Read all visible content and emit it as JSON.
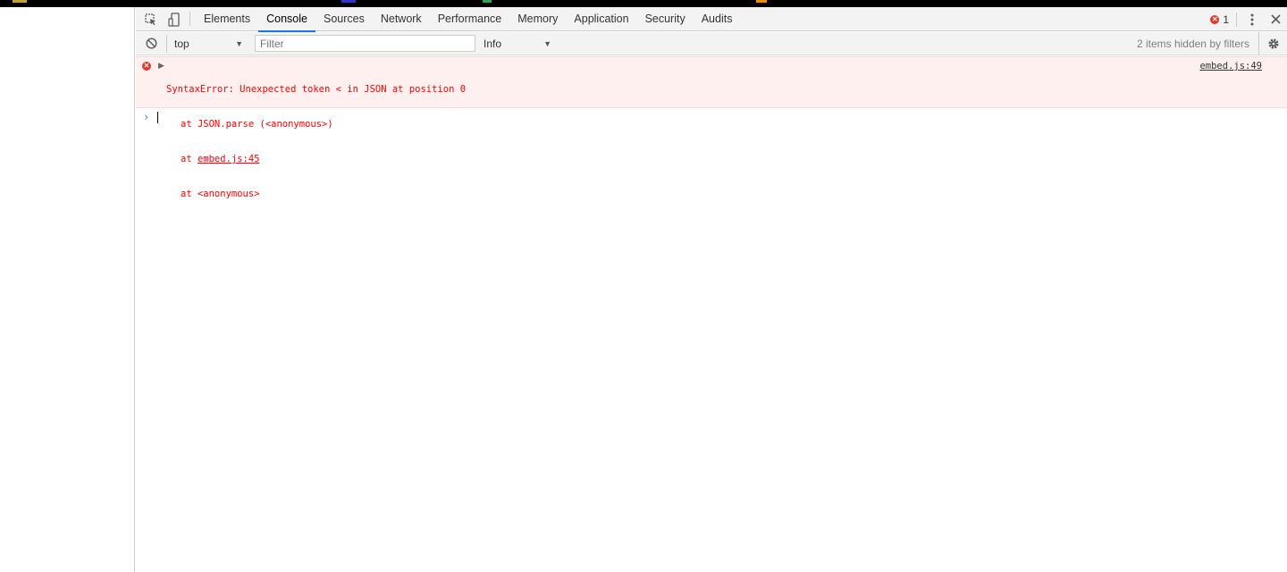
{
  "devtools": {
    "tabs": [
      {
        "label": "Elements"
      },
      {
        "label": "Console"
      },
      {
        "label": "Sources"
      },
      {
        "label": "Network"
      },
      {
        "label": "Performance"
      },
      {
        "label": "Memory"
      },
      {
        "label": "Application"
      },
      {
        "label": "Security"
      },
      {
        "label": "Audits"
      }
    ],
    "active_tab": "Console",
    "error_count": "1",
    "icons": {
      "inspect": "inspect-element-icon",
      "device": "device-toolbar-icon",
      "menu": "kebab-menu-icon",
      "close": "close-icon"
    }
  },
  "toolbar": {
    "context": "top",
    "filter_placeholder": "Filter",
    "level": "Info",
    "hidden_note": "2 items hidden by filters",
    "icons": {
      "clear": "clear-console-icon",
      "settings": "gear-icon"
    }
  },
  "console": {
    "error": {
      "message": "SyntaxError: Unexpected token < in JSON at position 0",
      "stack": [
        {
          "prefix": "at ",
          "text": "JSON.parse (<anonymous>)"
        },
        {
          "prefix": "at ",
          "text": "embed.js:45"
        },
        {
          "prefix": "at ",
          "text": "<anonymous>"
        }
      ],
      "source": "embed.js:49"
    },
    "prompt_symbol": "›"
  },
  "colors": {
    "error_red": "#ff0000",
    "error_bg": "#fff0f0",
    "accent_blue": "#1a73e8"
  }
}
